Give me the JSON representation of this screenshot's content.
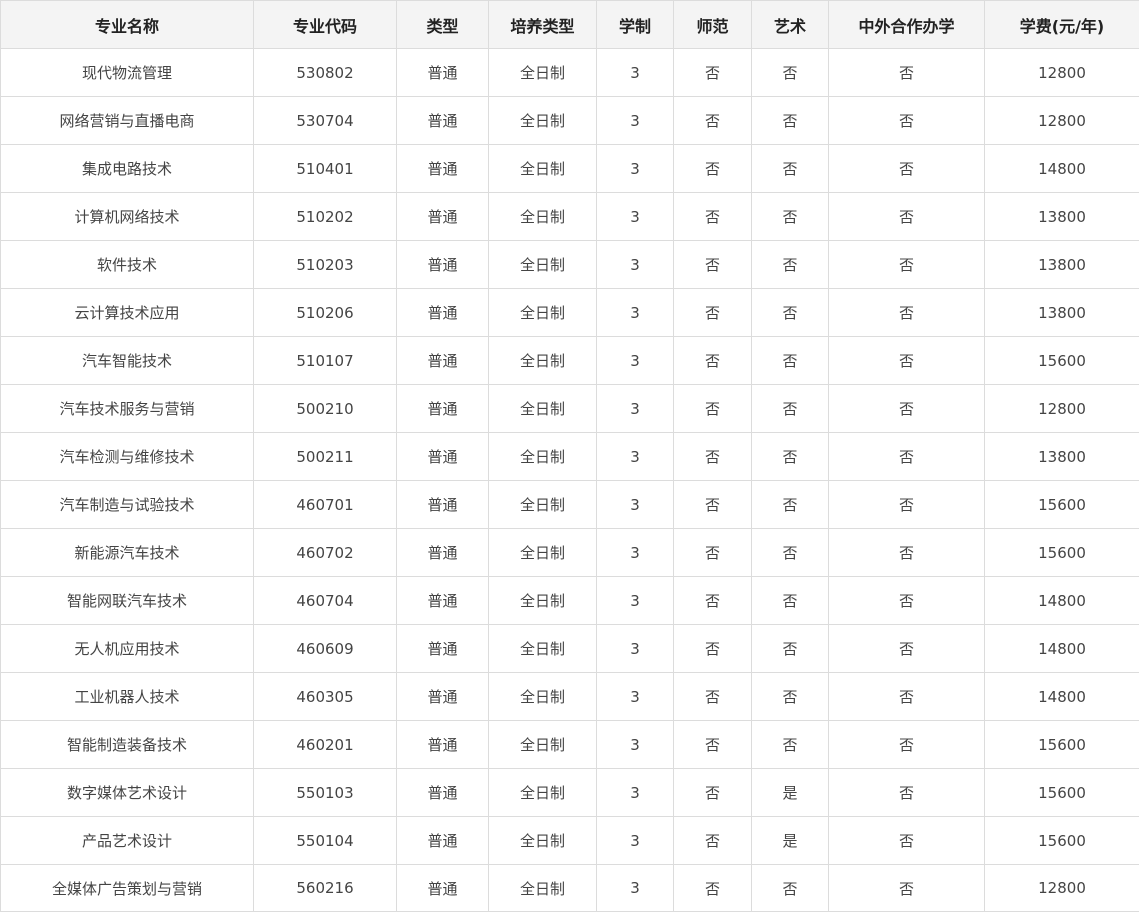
{
  "table": {
    "headers": [
      "专业名称",
      "专业代码",
      "类型",
      "培养类型",
      "学制",
      "师范",
      "艺术",
      "中外合作办学",
      "学费(元/年)"
    ],
    "rows": [
      [
        "现代物流管理",
        "530802",
        "普通",
        "全日制",
        "3",
        "否",
        "否",
        "否",
        "12800"
      ],
      [
        "网络营销与直播电商",
        "530704",
        "普通",
        "全日制",
        "3",
        "否",
        "否",
        "否",
        "12800"
      ],
      [
        "集成电路技术",
        "510401",
        "普通",
        "全日制",
        "3",
        "否",
        "否",
        "否",
        "14800"
      ],
      [
        "计算机网络技术",
        "510202",
        "普通",
        "全日制",
        "3",
        "否",
        "否",
        "否",
        "13800"
      ],
      [
        "软件技术",
        "510203",
        "普通",
        "全日制",
        "3",
        "否",
        "否",
        "否",
        "13800"
      ],
      [
        "云计算技术应用",
        "510206",
        "普通",
        "全日制",
        "3",
        "否",
        "否",
        "否",
        "13800"
      ],
      [
        "汽车智能技术",
        "510107",
        "普通",
        "全日制",
        "3",
        "否",
        "否",
        "否",
        "15600"
      ],
      [
        "汽车技术服务与营销",
        "500210",
        "普通",
        "全日制",
        "3",
        "否",
        "否",
        "否",
        "12800"
      ],
      [
        "汽车检测与维修技术",
        "500211",
        "普通",
        "全日制",
        "3",
        "否",
        "否",
        "否",
        "13800"
      ],
      [
        "汽车制造与试验技术",
        "460701",
        "普通",
        "全日制",
        "3",
        "否",
        "否",
        "否",
        "15600"
      ],
      [
        "新能源汽车技术",
        "460702",
        "普通",
        "全日制",
        "3",
        "否",
        "否",
        "否",
        "15600"
      ],
      [
        "智能网联汽车技术",
        "460704",
        "普通",
        "全日制",
        "3",
        "否",
        "否",
        "否",
        "14800"
      ],
      [
        "无人机应用技术",
        "460609",
        "普通",
        "全日制",
        "3",
        "否",
        "否",
        "否",
        "14800"
      ],
      [
        "工业机器人技术",
        "460305",
        "普通",
        "全日制",
        "3",
        "否",
        "否",
        "否",
        "14800"
      ],
      [
        "智能制造装备技术",
        "460201",
        "普通",
        "全日制",
        "3",
        "否",
        "否",
        "否",
        "15600"
      ],
      [
        "数字媒体艺术设计",
        "550103",
        "普通",
        "全日制",
        "3",
        "否",
        "是",
        "否",
        "15600"
      ],
      [
        "产品艺术设计",
        "550104",
        "普通",
        "全日制",
        "3",
        "否",
        "是",
        "否",
        "15600"
      ],
      [
        "全媒体广告策划与营销",
        "560216",
        "普通",
        "全日制",
        "3",
        "否",
        "否",
        "否",
        "12800"
      ]
    ]
  }
}
